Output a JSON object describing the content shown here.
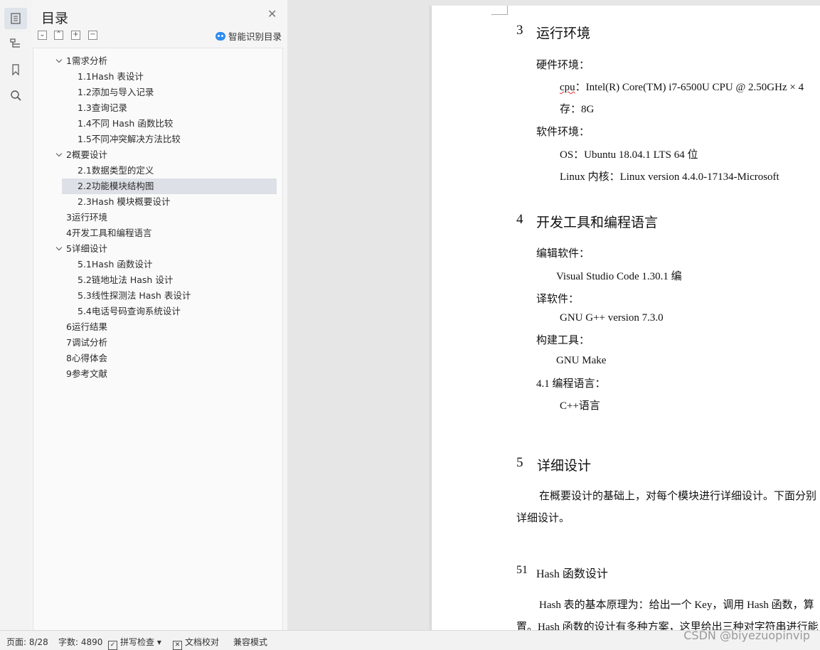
{
  "toc": {
    "title": "目录",
    "smart_label": "智能识别目录",
    "controls": [
      "collapse-all",
      "expand-all",
      "add",
      "remove"
    ],
    "items": [
      {
        "label": "1需求分析",
        "level": 1,
        "expanded": true
      },
      {
        "label": "1.1Hash 表设计",
        "level": 2
      },
      {
        "label": "1.2添加与导入记录",
        "level": 2
      },
      {
        "label": "1.3查询记录",
        "level": 2
      },
      {
        "label": "1.4不同 Hash 函数比较",
        "level": 2
      },
      {
        "label": "1.5不同冲突解决方法比较",
        "level": 2
      },
      {
        "label": "2概要设计",
        "level": 1,
        "expanded": true
      },
      {
        "label": "2.1数据类型的定义",
        "level": 2
      },
      {
        "label": "2.2功能模块结构图",
        "level": 2,
        "selected": true
      },
      {
        "label": "2.3Hash 模块概要设计",
        "level": 2
      },
      {
        "label": "3运行环境",
        "level": 1
      },
      {
        "label": "4开发工具和编程语言",
        "level": 1
      },
      {
        "label": "5详细设计",
        "level": 1,
        "expanded": true
      },
      {
        "label": "5.1Hash 函数设计",
        "level": 2
      },
      {
        "label": "5.2链地址法 Hash 设计",
        "level": 2
      },
      {
        "label": "5.3线性探测法 Hash 表设计",
        "level": 2
      },
      {
        "label": "5.4电话号码查询系统设计",
        "level": 2
      },
      {
        "label": "6运行结果",
        "level": 1
      },
      {
        "label": "7调试分析",
        "level": 1
      },
      {
        "label": "8心得体会",
        "level": 1
      },
      {
        "label": "9参考文献",
        "level": 1
      }
    ]
  },
  "tools": [
    "toc-icon",
    "navigation-icon",
    "bookmark-icon",
    "search-icon"
  ],
  "doc": {
    "h3_num": "3",
    "h3": "运行环境",
    "hw_label": "硬件环境：",
    "cpu_key": "cpu",
    "cpu_val": "：Intel(R) Core(TM) i7-6500U CPU @ 2.50GHz × 4",
    "mem": "存：8G",
    "sw_label": "软件环境：",
    "os": "OS：Ubuntu 18.04.1 LTS 64 位",
    "kernel": "Linux 内核：Linux version 4.4.0-17134-Microsoft",
    "h4_num": "4",
    "h4": "开发工具和编程语言",
    "editor_label": "编辑软件：",
    "editor": "Visual Studio Code 1.30.1 编",
    "compiler_label": "译软件：",
    "compiler": "GNU G++ version 7.3.0",
    "build_label": "构建工具：",
    "build": "GNU Make",
    "lang_label": "4.1 编程语言：",
    "lang": "C++语言",
    "h5_num": "5",
    "h5": "详细设计",
    "p5_line1": "在概要设计的基础上，对每个模块进行详细设计。下面分别",
    "p5_line2": "详细设计。",
    "h51_num": "51",
    "h51": "Hash 函数设计",
    "p51_line1": "Hash 表的基本原理为：给出一个 Key，调用 Hash 函数，算",
    "p51_line2": "置。Hash 函数的设计有多种方案，这里给出三种对字符串进行能"
  },
  "status": {
    "page": "页面: 8/28",
    "words": "字数: 4890",
    "spell": "拼写检查",
    "proof": "文档校对",
    "compat": "兼容模式",
    "watermark": "CSDN @biyezuopinvip"
  }
}
